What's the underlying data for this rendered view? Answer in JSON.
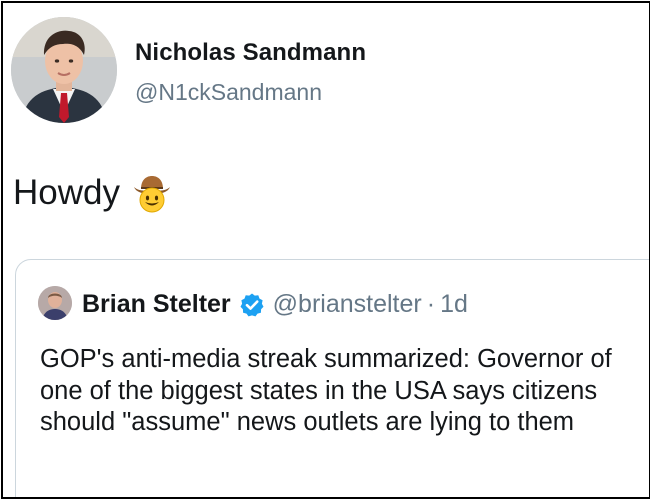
{
  "tweet": {
    "author_name": "Nicholas Sandmann",
    "author_handle": "@N1ckSandmann",
    "text": "Howdy",
    "emoji": "cowboy-hat-face-icon"
  },
  "quoted_tweet": {
    "author_name": "Brian Stelter",
    "author_handle": "@brianstelter",
    "separator": "·",
    "time": "1d",
    "verified_icon": "verified-badge-icon",
    "text": "GOP's anti-media streak summarized: Governor of one of the biggest states in the USA says citizens should \"assume\" news outlets are lying to them"
  },
  "colors": {
    "text_primary": "#14171a",
    "text_secondary": "#657786",
    "verified_blue": "#1da1f2",
    "card_border": "#ccd6dd"
  }
}
